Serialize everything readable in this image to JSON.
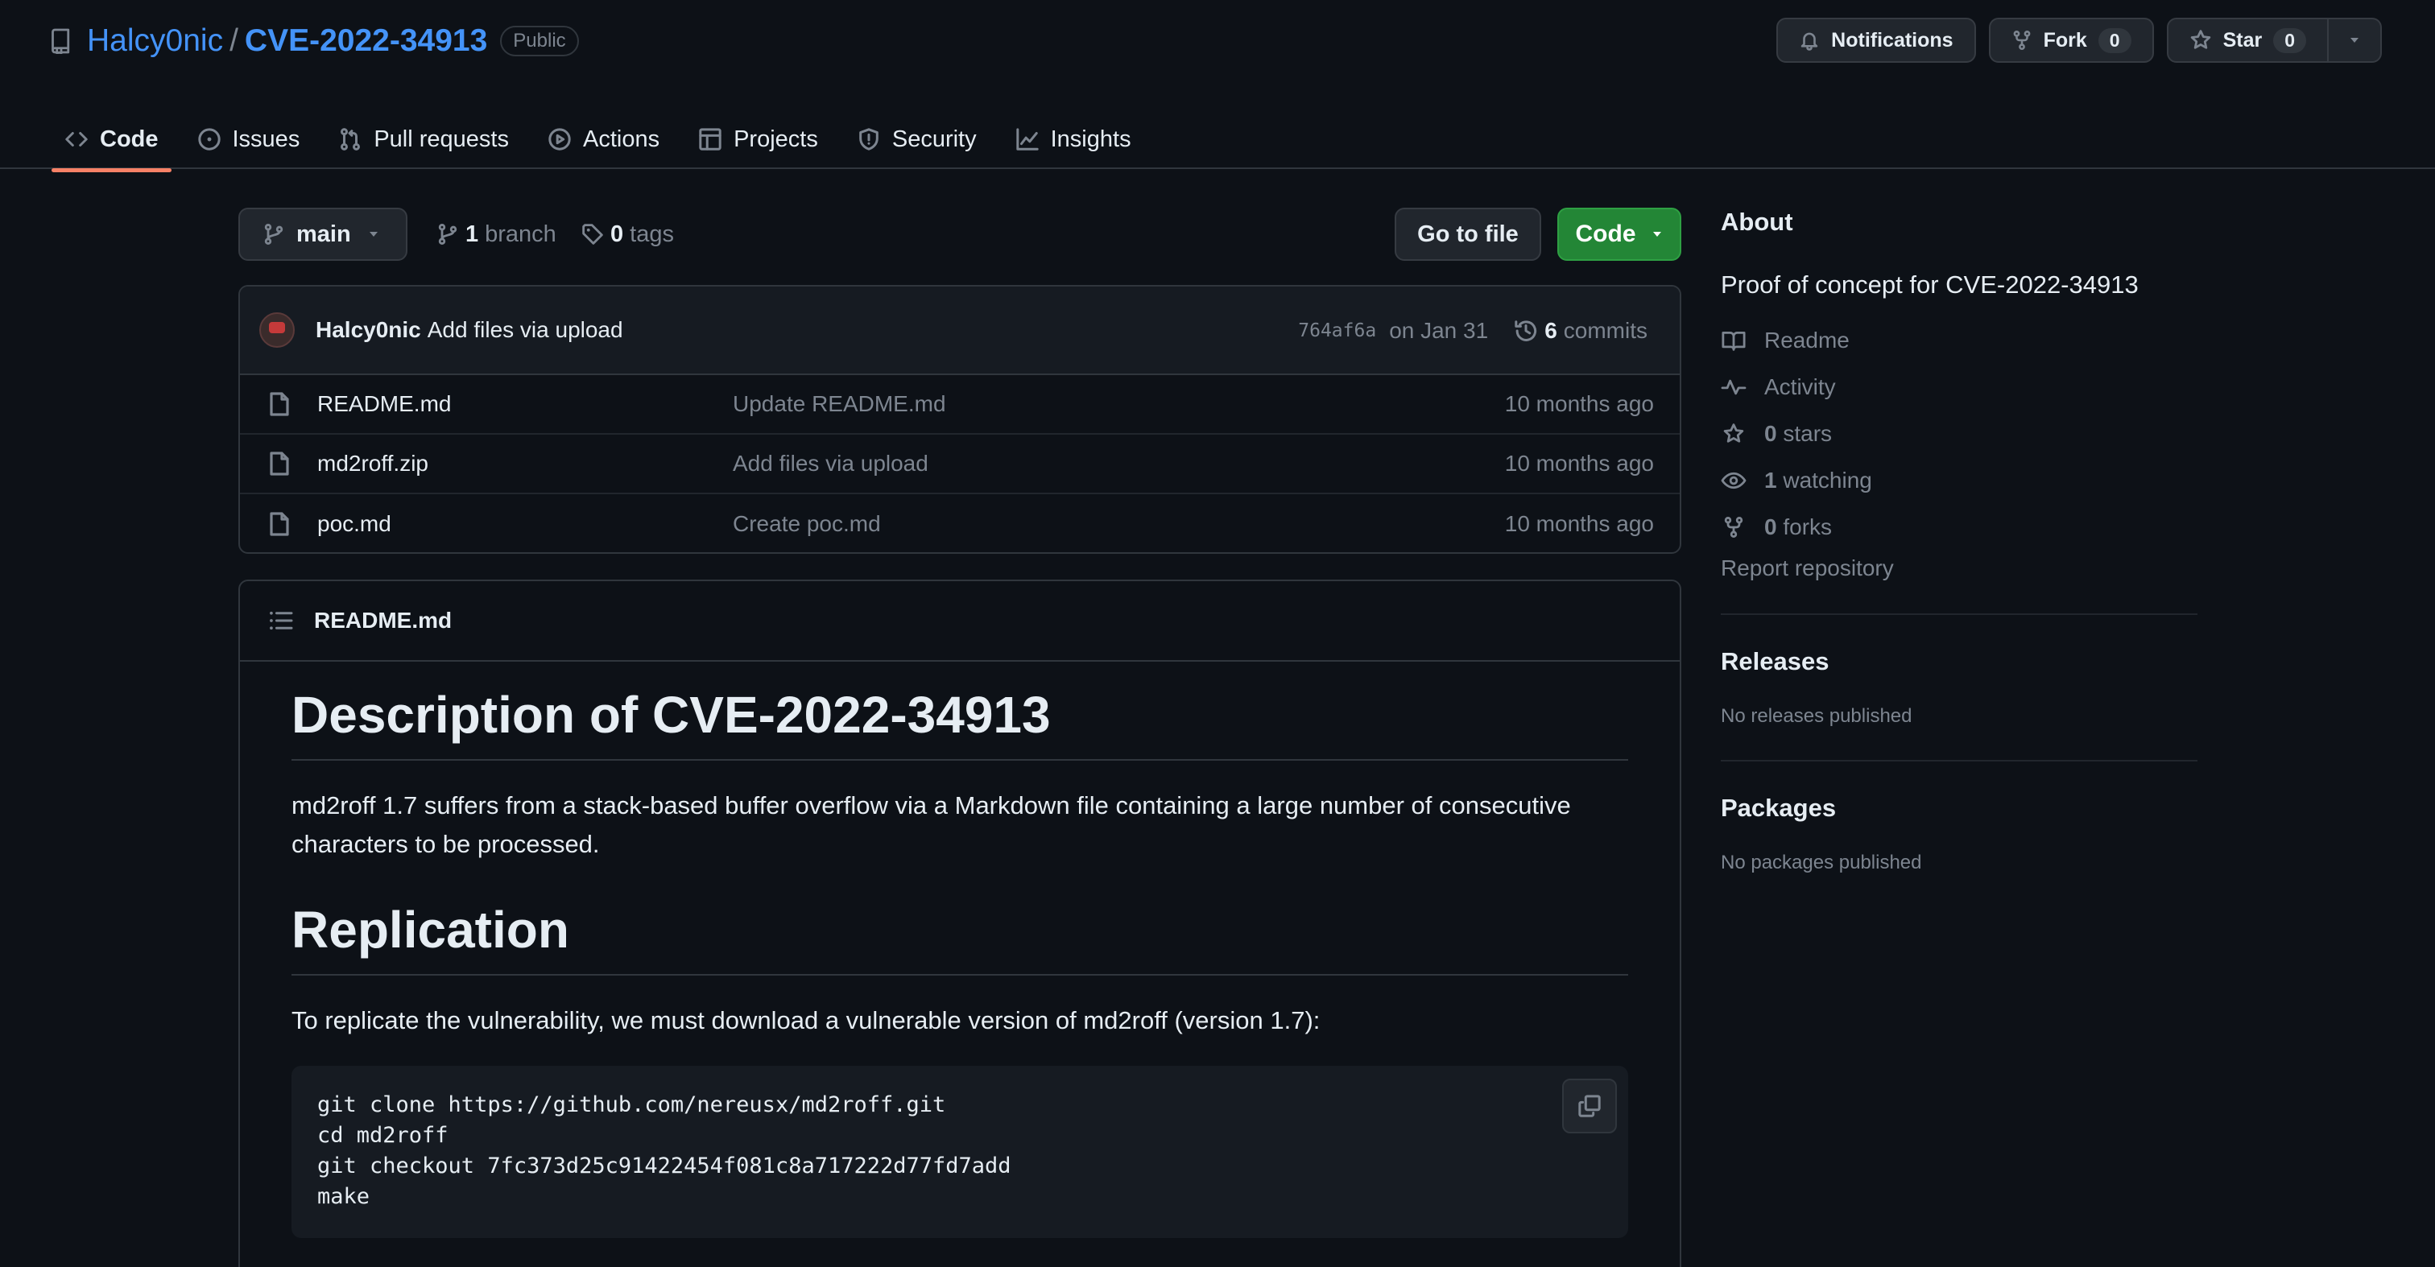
{
  "repo": {
    "owner": "Halcy0nic",
    "name": "CVE-2022-34913",
    "visibility": "Public"
  },
  "header_buttons": {
    "notifications": "Notifications",
    "fork_label": "Fork",
    "fork_count": "0",
    "star_label": "Star",
    "star_count": "0"
  },
  "tabs": [
    {
      "label": "Code",
      "icon": "code-icon",
      "selected": true
    },
    {
      "label": "Issues",
      "icon": "issue-opened-icon"
    },
    {
      "label": "Pull requests",
      "icon": "git-pull-request-icon"
    },
    {
      "label": "Actions",
      "icon": "play-icon"
    },
    {
      "label": "Projects",
      "icon": "table-icon"
    },
    {
      "label": "Security",
      "icon": "shield-icon"
    },
    {
      "label": "Insights",
      "icon": "graph-icon"
    }
  ],
  "toolbar": {
    "branch": "main",
    "branch_count": "1",
    "branch_label": "branch",
    "tag_count": "0",
    "tag_label": "tags",
    "goto_file": "Go to file",
    "code": "Code"
  },
  "latest_commit": {
    "author": "Halcy0nic",
    "message": "Add files via upload",
    "sha": "764af6a",
    "date": "on Jan 31",
    "commit_count": "6",
    "commit_label": "commits"
  },
  "files": [
    {
      "name": "README.md",
      "commit": "Update README.md",
      "age": "10 months ago"
    },
    {
      "name": "md2roff.zip",
      "commit": "Add files via upload",
      "age": "10 months ago"
    },
    {
      "name": "poc.md",
      "commit": "Create poc.md",
      "age": "10 months ago"
    }
  ],
  "readme": {
    "filename": "README.md",
    "h1": "Description of CVE-2022-34913",
    "p1": "md2roff 1.7 suffers from a stack-based buffer overflow via a Markdown file containing a large number of consecutive characters to be processed.",
    "h2": "Replication",
    "p2": "To replicate the vulnerability, we must download a vulnerable version of md2roff (version 1.7):",
    "code_lines": [
      "git clone https://github.com/nereusx/md2roff.git",
      "cd md2roff",
      "git checkout 7fc373d25c91422454f081c8a717222d77fd7add",
      "make"
    ]
  },
  "sidebar": {
    "about_heading": "About",
    "about_desc": "Proof of concept for CVE-2022-34913",
    "items": {
      "readme": "Readme",
      "activity": "Activity",
      "stars_count": "0",
      "stars_label": "stars",
      "watching_count": "1",
      "watching_label": "watching",
      "forks_count": "0",
      "forks_label": "forks"
    },
    "report": "Report repository",
    "releases_heading": "Releases",
    "releases_empty": "No releases published",
    "packages_heading": "Packages",
    "packages_empty": "No packages published"
  },
  "colors": {
    "background": "#0d1117",
    "link": "#4493f8",
    "primary_button": "#238636",
    "tab_underline": "#f78166"
  }
}
